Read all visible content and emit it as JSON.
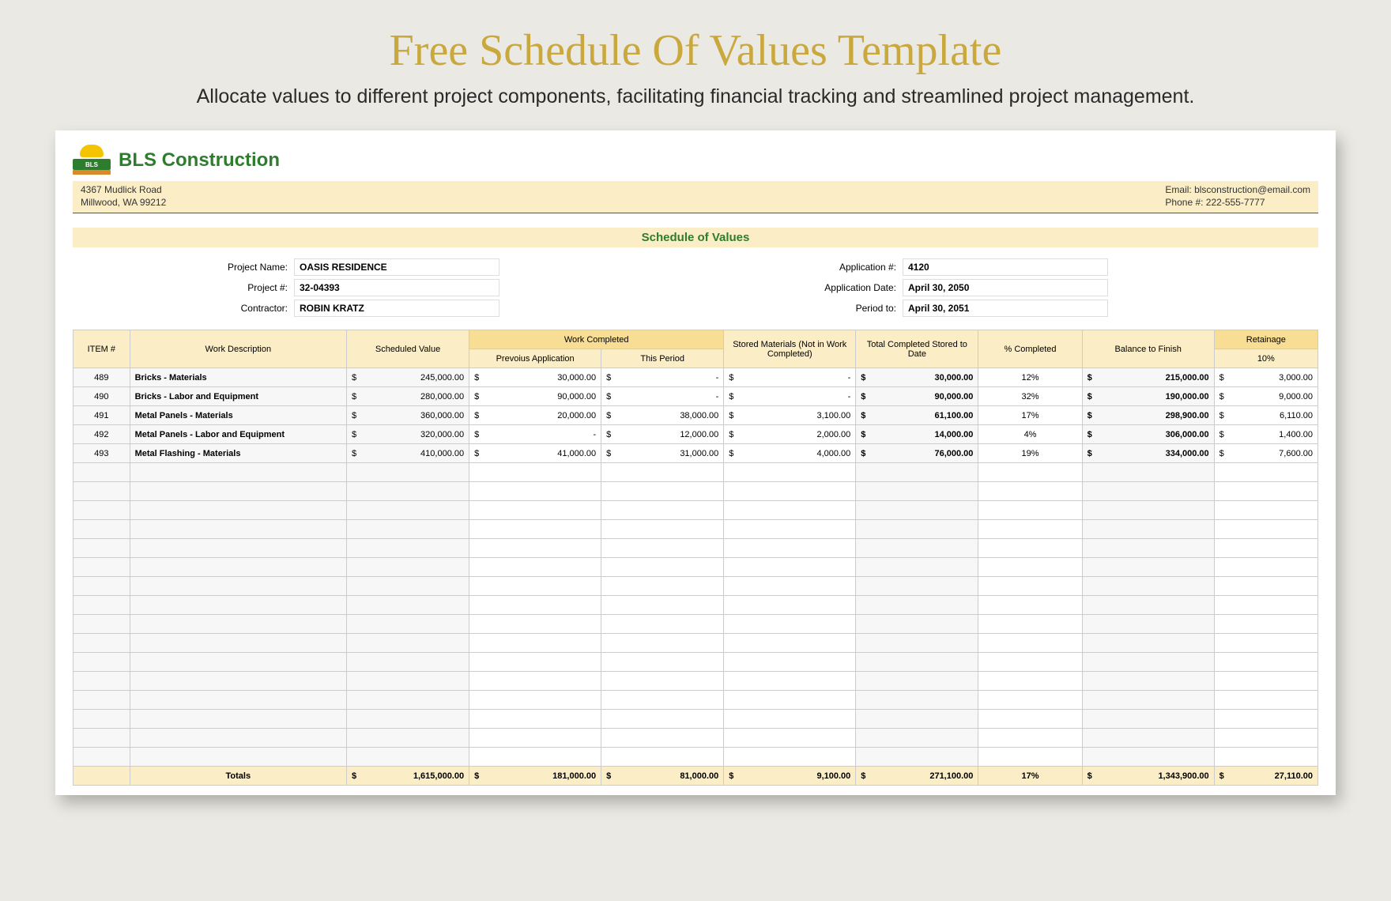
{
  "page": {
    "title": "Free Schedule Of Values Template",
    "subtitle": "Allocate values to different project components, facilitating financial tracking and streamlined project management."
  },
  "company": {
    "name": "BLS Construction",
    "logo_text": "BLS",
    "address1": "4367 Mudlick Road",
    "address2": "Millwood, WA 99212",
    "email_label": "Email: blsconstruction@email.com",
    "phone_label": "Phone #: 222-555-7777"
  },
  "doc_title": "Schedule of Values",
  "meta_left": {
    "project_name_lbl": "Project Name:",
    "project_name": "OASIS RESIDENCE",
    "project_num_lbl": "Project #:",
    "project_num": "32-04393",
    "contractor_lbl": "Contractor:",
    "contractor": "ROBIN KRATZ"
  },
  "meta_right": {
    "app_num_lbl": "Application #:",
    "app_num": "4120",
    "app_date_lbl": "Application Date:",
    "app_date": "April 30, 2050",
    "period_lbl": "Period to:",
    "period": "April 30, 2051"
  },
  "headers": {
    "item": "ITEM #",
    "desc": "Work Description",
    "sched": "Scheduled Value",
    "work_completed": "Work Completed",
    "prev": "Prevoius Application",
    "this_period": "This Period",
    "stored": "Stored Materials (Not in Work Completed)",
    "total_stored": "Total Completed Stored to Date",
    "pct": "% Completed",
    "balance": "Balance to Finish",
    "retainage": "Retainage",
    "retainage_pct": "10%"
  },
  "rows": [
    {
      "item": "489",
      "desc": "Bricks - Materials",
      "sched": "245,000.00",
      "prev": "30,000.00",
      "period": "-",
      "stored": "-",
      "total": "30,000.00",
      "pct": "12%",
      "bal": "215,000.00",
      "ret": "3,000.00"
    },
    {
      "item": "490",
      "desc": "Bricks - Labor and Equipment",
      "sched": "280,000.00",
      "prev": "90,000.00",
      "period": "-",
      "stored": "-",
      "total": "90,000.00",
      "pct": "32%",
      "bal": "190,000.00",
      "ret": "9,000.00"
    },
    {
      "item": "491",
      "desc": "Metal Panels - Materials",
      "sched": "360,000.00",
      "prev": "20,000.00",
      "period": "38,000.00",
      "stored": "3,100.00",
      "total": "61,100.00",
      "pct": "17%",
      "bal": "298,900.00",
      "ret": "6,110.00"
    },
    {
      "item": "492",
      "desc": "Metal Panels - Labor and Equipment",
      "sched": "320,000.00",
      "prev": "-",
      "period": "12,000.00",
      "stored": "2,000.00",
      "total": "14,000.00",
      "pct": "4%",
      "bal": "306,000.00",
      "ret": "1,400.00"
    },
    {
      "item": "493",
      "desc": "Metal Flashing - Materials",
      "sched": "410,000.00",
      "prev": "41,000.00",
      "period": "31,000.00",
      "stored": "4,000.00",
      "total": "76,000.00",
      "pct": "19%",
      "bal": "334,000.00",
      "ret": "7,600.00"
    }
  ],
  "empty_rows": 16,
  "totals": {
    "label": "Totals",
    "sched": "1,615,000.00",
    "prev": "181,000.00",
    "period": "81,000.00",
    "stored": "9,100.00",
    "total": "271,100.00",
    "pct": "17%",
    "bal": "1,343,900.00",
    "ret": "27,110.00"
  }
}
